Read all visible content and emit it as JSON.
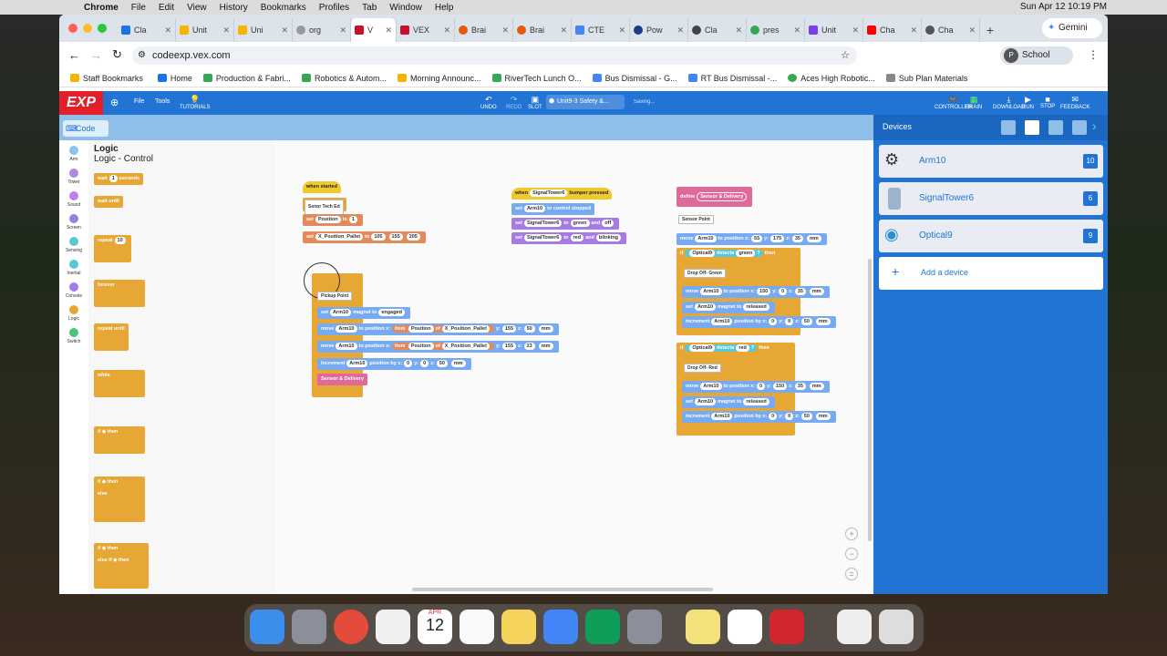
{
  "menubar": {
    "app": "Chrome",
    "items": [
      "File",
      "Edit",
      "View",
      "History",
      "Bookmarks",
      "Profiles",
      "Tab",
      "Window",
      "Help"
    ],
    "clock": "Sun Apr 12  10:19 PM"
  },
  "tabs": [
    {
      "label": "Cla"
    },
    {
      "label": "Unit"
    },
    {
      "label": "Uni"
    },
    {
      "label": "org"
    },
    {
      "label": "V"
    },
    {
      "label": "VEX"
    },
    {
      "label": "Brai"
    },
    {
      "label": "Brai"
    },
    {
      "label": "CTE"
    },
    {
      "label": "Pow"
    },
    {
      "label": "Cla"
    },
    {
      "label": "pres"
    },
    {
      "label": "Unit"
    },
    {
      "label": "Cha"
    },
    {
      "label": "Cha"
    }
  ],
  "gemini_label": "Gemini",
  "address": {
    "url": "codeexp.vex.com",
    "profile": "School"
  },
  "bookmarks": [
    "Staff Bookmarks",
    "Home",
    "Production & Fabri...",
    "Robotics & Autom...",
    "Morning Announc...",
    "RiverTech Lunch O...",
    "Bus Dismissal - G...",
    "RT Bus Dismissal -...",
    "Aces High Robotic...",
    "Sub Plan Materials"
  ],
  "vex": {
    "logo": "EXP",
    "file": "File",
    "tools": "Tools",
    "tutorials": "TUTORIALS",
    "undo": "UNDO",
    "redo": "REDO",
    "slot": "SLOT",
    "project": "Unit9-3 Safety &...",
    "status": "Saving...",
    "controller": "CONTROLLER",
    "brain": "BRAIN",
    "download": "DOWNLOAD",
    "run": "RUN",
    "stop": "STOP",
    "feedback": "FEEDBACK"
  },
  "code_tab": "Code",
  "categories": [
    "Arm",
    "Tower",
    "Sound",
    "Screen",
    "Sensing",
    "Inertial",
    "Console",
    "Logic",
    "Switch"
  ],
  "flyout": {
    "title": "Logic",
    "subtitle": "Logic - Control",
    "blocks": [
      "wait",
      "1",
      "seconds",
      "wait until",
      "repeat",
      "10",
      "forever",
      "repeat until",
      "while",
      "if",
      "then",
      "if",
      "then",
      "else",
      "if",
      "then",
      "else if",
      "then"
    ]
  },
  "canvas": {
    "s1": [
      "when started",
      "Senor Tech Ed",
      "set",
      "Position",
      "to",
      "1",
      "set",
      "X_Position_Pallet",
      "to",
      "105",
      "155",
      "205"
    ],
    "s2": [
      "Pickup Point",
      "set",
      "Arm10",
      "magnet to",
      "engaged",
      "move",
      "Arm10",
      "to position x:",
      "item",
      "Position",
      "of",
      "X_Position_Pallet",
      "y:",
      "155",
      "z:",
      "50",
      "mm",
      "move",
      "Arm10",
      "to position x:",
      "item",
      "Position",
      "of",
      "X_Position_Pallet",
      "y:",
      "155",
      "z:",
      "23",
      "mm",
      "increment",
      "Arm10",
      "position by x:",
      "0",
      "y:",
      "0",
      "z:",
      "50",
      "mm",
      "Sensor & Delivery"
    ],
    "s3": [
      "when",
      "SignalTower6",
      "bumper pressed",
      "set",
      "Arm10",
      "to control stopped",
      "set",
      "SignalTower6",
      "to",
      "green",
      "and",
      "off",
      "set",
      "SignalTower6",
      "to",
      "red",
      "and",
      "blinking"
    ],
    "s4": [
      "define",
      "Sensor & Delivery",
      "Sensor Point",
      "move",
      "Arm10",
      "to position x:",
      "55",
      "y:",
      "175",
      "z:",
      "35",
      "mm",
      "if",
      "Optical9",
      "detects",
      "green",
      "?",
      "then",
      "Drop Off- Green",
      "move",
      "Arm10",
      "to position x:",
      "150",
      "y:",
      "0",
      "z:",
      "35",
      "mm",
      "set",
      "Arm10",
      "magnet to",
      "released",
      "increment",
      "Arm10",
      "position by x:",
      "0",
      "y:",
      "0",
      "z:",
      "50",
      "mm",
      "if",
      "Optical9",
      "detects",
      "red",
      "?",
      "then",
      "Drop Off- Red",
      "move",
      "Arm10",
      "to position x:",
      "0",
      "y:",
      "150",
      "z:",
      "35",
      "mm",
      "set",
      "Arm10",
      "magnet to",
      "released",
      "increment",
      "Arm10",
      "position by x:",
      "0",
      "y:",
      "0",
      "z:",
      "50",
      "mm"
    ]
  },
  "devices": {
    "title": "Devices",
    "list": [
      {
        "name": "Arm10",
        "port": "10"
      },
      {
        "name": "SignalTower6",
        "port": "6"
      },
      {
        "name": "Optical9",
        "port": "9"
      }
    ],
    "add": "Add a device"
  },
  "dock_date": {
    "month": "APR",
    "day": "12"
  }
}
